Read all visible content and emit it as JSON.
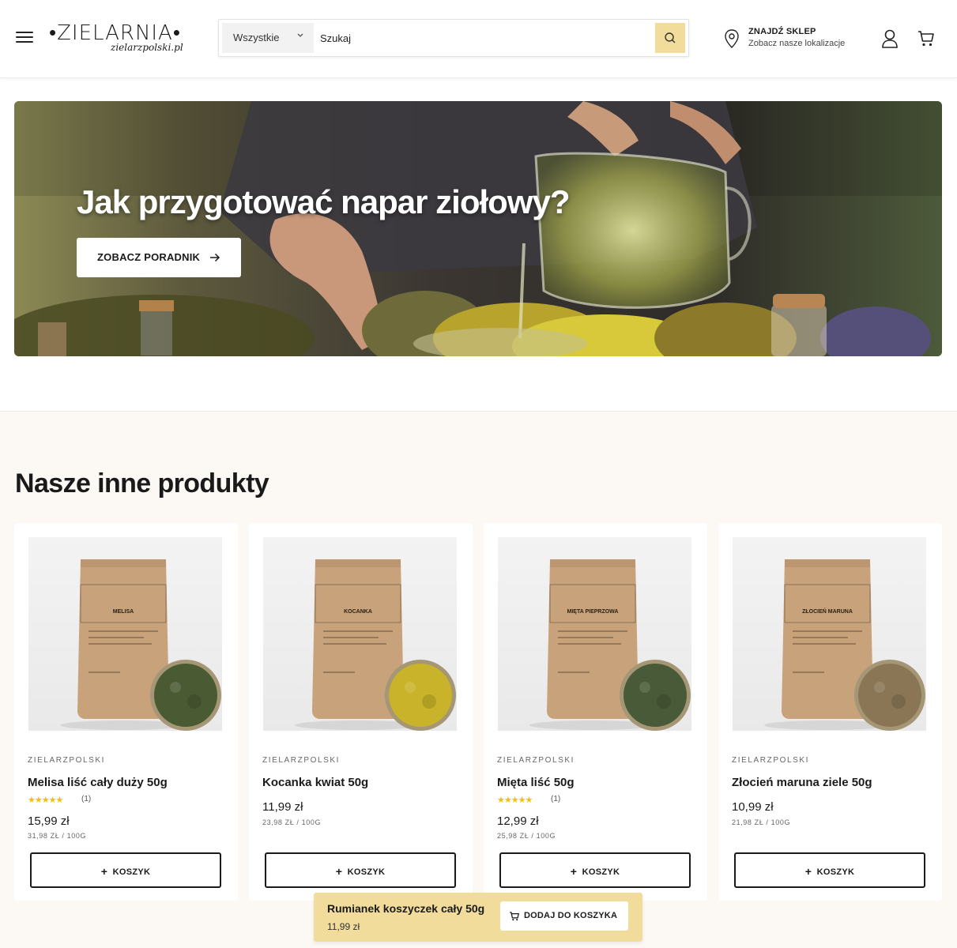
{
  "header": {
    "logo_main": "•ZIELARNIA•",
    "logo_sub": "zielarzpolski.pl",
    "search": {
      "category": "Wszystkie",
      "placeholder": "Szukaj"
    },
    "store": {
      "title": "ZNAJDŹ SKLEP",
      "subtitle": "Zobacz nasze lokalizacje"
    }
  },
  "hero": {
    "title": "Jak przygotować napar ziołowy?",
    "button_label": "ZOBACZ PORADNIK"
  },
  "products": {
    "section_title": "Nasze inne produkty",
    "add_label": "KOSZYK",
    "items": [
      {
        "brand": "ZIELARZPOLSKI",
        "name": "Melisa liść cały duży 50g",
        "pack_label": "MELISA",
        "rating": 5,
        "review_count": "(1)",
        "price": "15,99 zł",
        "unit_price": "31,98 ZŁ / 100G",
        "herb_color": "#4a5a33"
      },
      {
        "brand": "ZIELARZPOLSKI",
        "name": "Kocanka kwiat 50g",
        "pack_label": "KOCANKA",
        "rating": null,
        "review_count": "",
        "price": "11,99 zł",
        "unit_price": "23,98 ZŁ / 100G",
        "herb_color": "#c8b32a"
      },
      {
        "brand": "ZIELARZPOLSKI",
        "name": "Mięta liść 50g",
        "pack_label": "MIĘTA PIEPRZOWA",
        "rating": 5,
        "review_count": "(1)",
        "price": "12,99 zł",
        "unit_price": "25,98 ZŁ / 100G",
        "herb_color": "#485a37"
      },
      {
        "brand": "ZIELARZPOLSKI",
        "name": "Złocień maruna ziele 50g",
        "pack_label": "ZŁOCIEŃ MARUNA",
        "rating": null,
        "review_count": "",
        "price": "10,99 zł",
        "unit_price": "21,98 ZŁ / 100G",
        "herb_color": "#8a7654"
      }
    ]
  },
  "sticky_bar": {
    "product_name": "Rumianek koszyczek cały 50g",
    "price": "11,99 zł",
    "button_label": "DODAJ DO KOSZYKA"
  },
  "colors": {
    "accent": "#f1dc9b",
    "star": "#f2c200",
    "section_bg": "#fcf9f4"
  },
  "icons": {
    "menu": "hamburger-icon",
    "search": "search-icon",
    "location": "map-pin-icon",
    "account": "user-icon",
    "cart": "cart-icon",
    "arrow": "arrow-right-icon"
  }
}
